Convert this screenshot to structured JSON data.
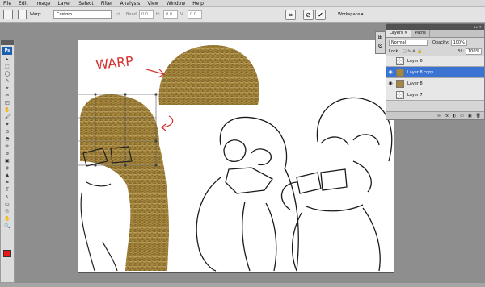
{
  "menubar": {
    "items": [
      "File",
      "Edit",
      "Image",
      "Layer",
      "Select",
      "Filter",
      "Analysis",
      "View",
      "Window",
      "Help"
    ]
  },
  "options": {
    "warp_label": "Warp:",
    "warp_value": "Custom",
    "bend_label": "Bend:",
    "bend_value": "0.0",
    "h_label": "H:",
    "h_value": "0.0",
    "v_label": "V:",
    "v_value": "0.0",
    "workspace_label": "Workspace ▾"
  },
  "tools": {
    "logo": "Ps",
    "glyphs": [
      "▸",
      "⬚",
      "◯",
      "✎",
      "⌖",
      "✂",
      "◰",
      "✋",
      "🖌",
      "✦",
      "⊙",
      "◓",
      "✏",
      "⌀",
      "▣",
      "◈",
      "▲",
      "✒",
      "T",
      "↖",
      "▭",
      "☉",
      "✋",
      "🔍"
    ],
    "fg_color": "#e81818",
    "bg_color": "#ffffff"
  },
  "canvas": {
    "annotation_text": "WARP",
    "annotation_color": "#d4322e",
    "hay_color": "#a7873c"
  },
  "layers_panel": {
    "tabs": [
      "Layers ×",
      "Paths"
    ],
    "blend_mode": "Normal",
    "opacity_label": "Opacity:",
    "opacity_value": "100%",
    "lock_label": "Lock:",
    "fill_label": "Fill:",
    "fill_value": "100%",
    "layers": [
      {
        "name": "Layer 6",
        "visible": false,
        "selected": false,
        "thumb": "checker"
      },
      {
        "name": "Layer 8 copy",
        "visible": true,
        "selected": true,
        "thumb": "hay"
      },
      {
        "name": "Layer 8",
        "visible": true,
        "selected": false,
        "thumb": "hay"
      },
      {
        "name": "Layer 7",
        "visible": false,
        "selected": false,
        "thumb": "checker"
      }
    ],
    "footer_icons": [
      "∞",
      "fx",
      "◐",
      "▭",
      "▣",
      "🗑"
    ]
  }
}
